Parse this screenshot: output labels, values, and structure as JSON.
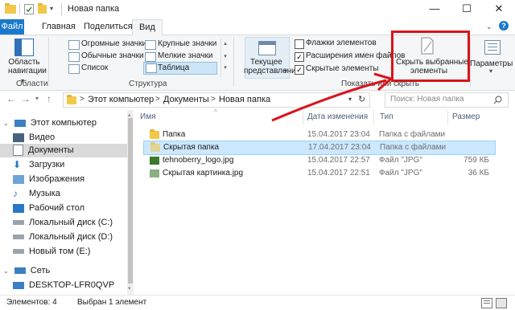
{
  "window": {
    "title": "Новая папка",
    "minimize": "—",
    "maximize": "☐",
    "close": "✕"
  },
  "tabs": {
    "file": "Файл",
    "home": "Главная",
    "share": "Поделиться",
    "view": "Вид"
  },
  "ribbon": {
    "panes": {
      "navigation_pane_l1": "Область",
      "navigation_pane_l2": "навигации",
      "group_label": "Области"
    },
    "layout": {
      "huge_icons": "Огромные значки",
      "normal_icons": "Обычные значки",
      "list": "Список",
      "large_icons": "Крупные значки",
      "small_icons": "Мелкие значки",
      "table": "Таблица",
      "group_label": "Структура"
    },
    "current_view": {
      "label_l1": "Текущее",
      "label_l2": "представление"
    },
    "show_hide": {
      "item_checkboxes": "Флажки элементов",
      "file_extensions": "Расширения имен файлов",
      "hidden_items": "Скрытые элементы",
      "hide_selected_l1": "Скрыть выбранные",
      "hide_selected_l2": "элементы",
      "group_label": "Показать или скрыть"
    },
    "options": "Параметры"
  },
  "address": {
    "crumbs": [
      "Этот компьютер",
      "Документы",
      "Новая папка"
    ],
    "separator": ">",
    "search_placeholder": "Поиск: Новая папка"
  },
  "nav": {
    "items": [
      {
        "label": "Этот компьютер",
        "icon": "computer-icon"
      },
      {
        "label": "Видео",
        "icon": "video-icon"
      },
      {
        "label": "Документы",
        "icon": "documents-icon",
        "selected": true
      },
      {
        "label": "Загрузки",
        "icon": "downloads-icon"
      },
      {
        "label": "Изображения",
        "icon": "pictures-icon"
      },
      {
        "label": "Музыка",
        "icon": "music-icon"
      },
      {
        "label": "Рабочий стол",
        "icon": "desktop-icon"
      },
      {
        "label": "Локальный диск (C:)",
        "icon": "drive-icon"
      },
      {
        "label": "Локальный диск (D:)",
        "icon": "drive-icon"
      },
      {
        "label": "Новый том (E:)",
        "icon": "drive-icon"
      },
      {
        "label": "Сеть",
        "icon": "network-icon"
      },
      {
        "label": "DESKTOP-LFR0QVP",
        "icon": "pc-icon"
      }
    ]
  },
  "columns": {
    "name": "Имя",
    "date": "Дата изменения",
    "type": "Тип",
    "size": "Размер"
  },
  "files": [
    {
      "name": "Папка",
      "date": "15.04.2017 23:04",
      "type": "Папка с файлами",
      "size": "",
      "icon": "folder-icon"
    },
    {
      "name": "Скрытая папка",
      "date": "17.04.2017 23:04",
      "type": "Папка с файлами",
      "size": "",
      "icon": "folder-icon",
      "selected": true
    },
    {
      "name": "tehnoberry_logo.jpg",
      "date": "15.04.2017 22:57",
      "type": "Файл \"JPG\"",
      "size": "759 КБ",
      "icon": "image-icon"
    },
    {
      "name": "Скрытая картинка.jpg",
      "date": "15.04.2017 22:51",
      "type": "Файл \"JPG\"",
      "size": "36 КБ",
      "icon": "image-icon"
    }
  ],
  "status": {
    "count": "Элементов: 4",
    "selected": "Выбран 1 элемент"
  },
  "colors": {
    "accent": "#1979ca",
    "selection_bg": "#cce8ff",
    "highlight_box": "#d9141b",
    "arrow": "#d9141b"
  }
}
